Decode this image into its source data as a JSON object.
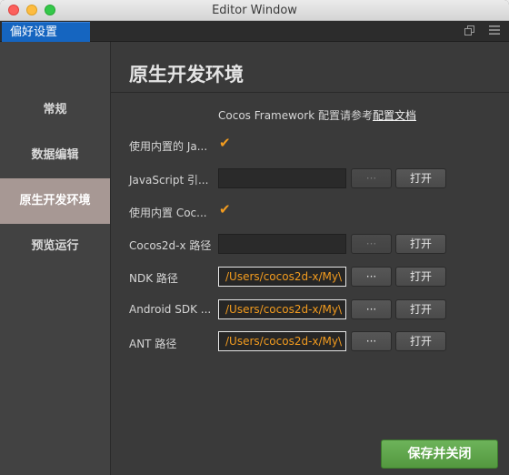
{
  "window": {
    "title": "Editor Window"
  },
  "tab": {
    "label": "偏好设置"
  },
  "toolbar": {
    "popout_icon": "popout-icon",
    "menu_icon": "hamburger-menu-icon"
  },
  "sidebar": {
    "items": [
      {
        "label": "常规",
        "active": false
      },
      {
        "label": "数据编辑",
        "active": false
      },
      {
        "label": "原生开发环境",
        "active": true
      },
      {
        "label": "预览运行",
        "active": false
      }
    ]
  },
  "main": {
    "title": "原生开发环境",
    "framework_note": "Cocos Framework 配置请参考",
    "framework_link": "配置文档",
    "rows": {
      "builtin_js": {
        "label": "使用内置的 Ja...",
        "checked": true
      },
      "js_engine": {
        "label": "JavaScript 引...",
        "value": "",
        "dots": "···",
        "open": "打开"
      },
      "builtin_cocos": {
        "label": "使用内置 Coc...",
        "checked": true
      },
      "cocos2dx_path": {
        "label": "Cocos2d-x 路径",
        "value": "",
        "dots": "···",
        "open": "打开"
      },
      "ndk_path": {
        "label": "NDK 路径",
        "value": "/Users/cocos2d-x/My\\",
        "dots": "···",
        "open": "打开"
      },
      "android_sdk": {
        "label": "Android SDK ...",
        "value": "/Users/cocos2d-x/My\\",
        "dots": "···",
        "open": "打开"
      },
      "ant_path": {
        "label": "ANT 路径",
        "value": "/Users/cocos2d-x/My\\",
        "dots": "···",
        "open": "打开"
      }
    },
    "save_label": "保存并关闭"
  },
  "colors": {
    "accent_tab": "#1565c0",
    "check": "#f39c1f",
    "save": "#5ca54a",
    "sidebar_active": "#a79894"
  }
}
